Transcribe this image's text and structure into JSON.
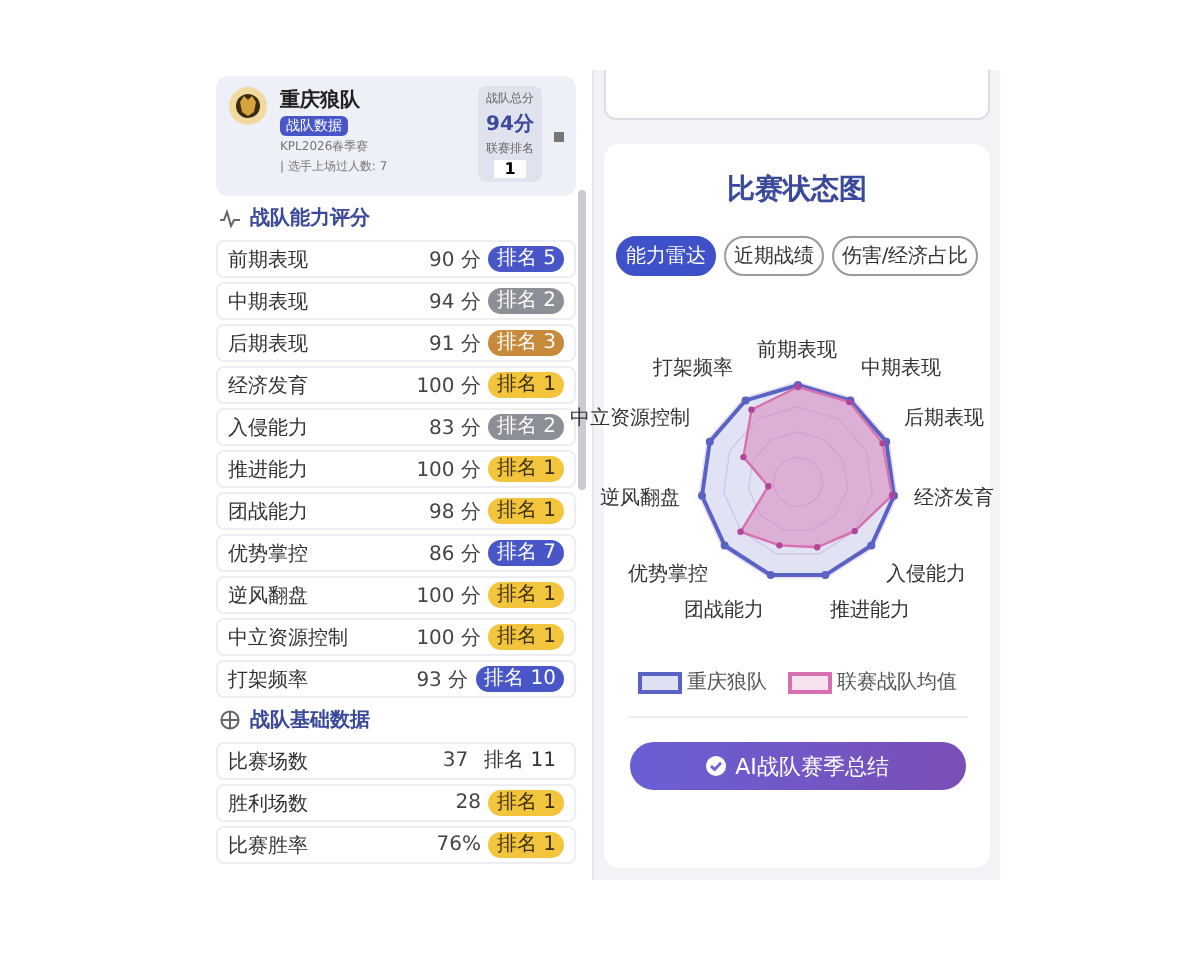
{
  "team": {
    "name": "重庆狼队",
    "tag": "战队数据",
    "season": "KPL2026春季赛",
    "players": "| 选手上场过人数: 7",
    "total_label": "战队总分",
    "total": "94分",
    "rank_label": "联赛排名",
    "rank": "1"
  },
  "ability": {
    "title": "战队能力评分",
    "rows": [
      {
        "label": "前期表现",
        "score": "90 分",
        "badge": "排名 5",
        "color": "#4856c8"
      },
      {
        "label": "中期表现",
        "score": "94 分",
        "badge": "排名 2",
        "color": "#8d8f96"
      },
      {
        "label": "后期表现",
        "score": "91 分",
        "badge": "排名 3",
        "color": "#c7893a"
      },
      {
        "label": "经济发育",
        "score": "100 分",
        "badge": "排名 1",
        "color": "#f2c53d"
      },
      {
        "label": "入侵能力",
        "score": "83 分",
        "badge": "排名 2",
        "color": "#8d8f96"
      },
      {
        "label": "推进能力",
        "score": "100 分",
        "badge": "排名 1",
        "color": "#f2c53d"
      },
      {
        "label": "团战能力",
        "score": "98 分",
        "badge": "排名 1",
        "color": "#f2c53d"
      },
      {
        "label": "优势掌控",
        "score": "86 分",
        "badge": "排名 7",
        "color": "#4856c8"
      },
      {
        "label": "逆风翻盘",
        "score": "100 分",
        "badge": "排名 1",
        "color": "#f2c53d"
      },
      {
        "label": "中立资源控制",
        "score": "100 分",
        "badge": "排名 1",
        "color": "#f2c53d"
      },
      {
        "label": "打架频率",
        "score": "93 分",
        "badge": "排名 10",
        "color": "#4856c8"
      }
    ]
  },
  "basic": {
    "title": "战队基础数据",
    "rows": [
      {
        "label": "比赛场数",
        "score": "37",
        "badge": "排名 11",
        "color": "#ffffff"
      },
      {
        "label": "胜利场数",
        "score": "28",
        "badge": "排名 1",
        "color": "#f2c53d"
      },
      {
        "label": "比赛胜率",
        "score": "76%",
        "badge": "排名 1",
        "color": "#f2c53d"
      }
    ]
  },
  "status": {
    "title": "比赛状态图",
    "tabs": [
      {
        "label": "能力雷达",
        "selected": true
      },
      {
        "label": "近期战绩",
        "selected": false
      },
      {
        "label": "伤害/经济占比",
        "selected": false
      }
    ],
    "axes": [
      "前期表现",
      "打架频率",
      "中期表现",
      "中立资源控制",
      "后期表现",
      "逆风翻盘",
      "经济发育",
      "优势掌控",
      "入侵能力",
      "团战能力",
      "推进能力"
    ],
    "legend": [
      {
        "label": "重庆狼队",
        "color": "#5a62c4"
      },
      {
        "label": "联赛战队均值",
        "color": "#d870b0"
      }
    ],
    "button": "AI战队赛季总结"
  }
}
